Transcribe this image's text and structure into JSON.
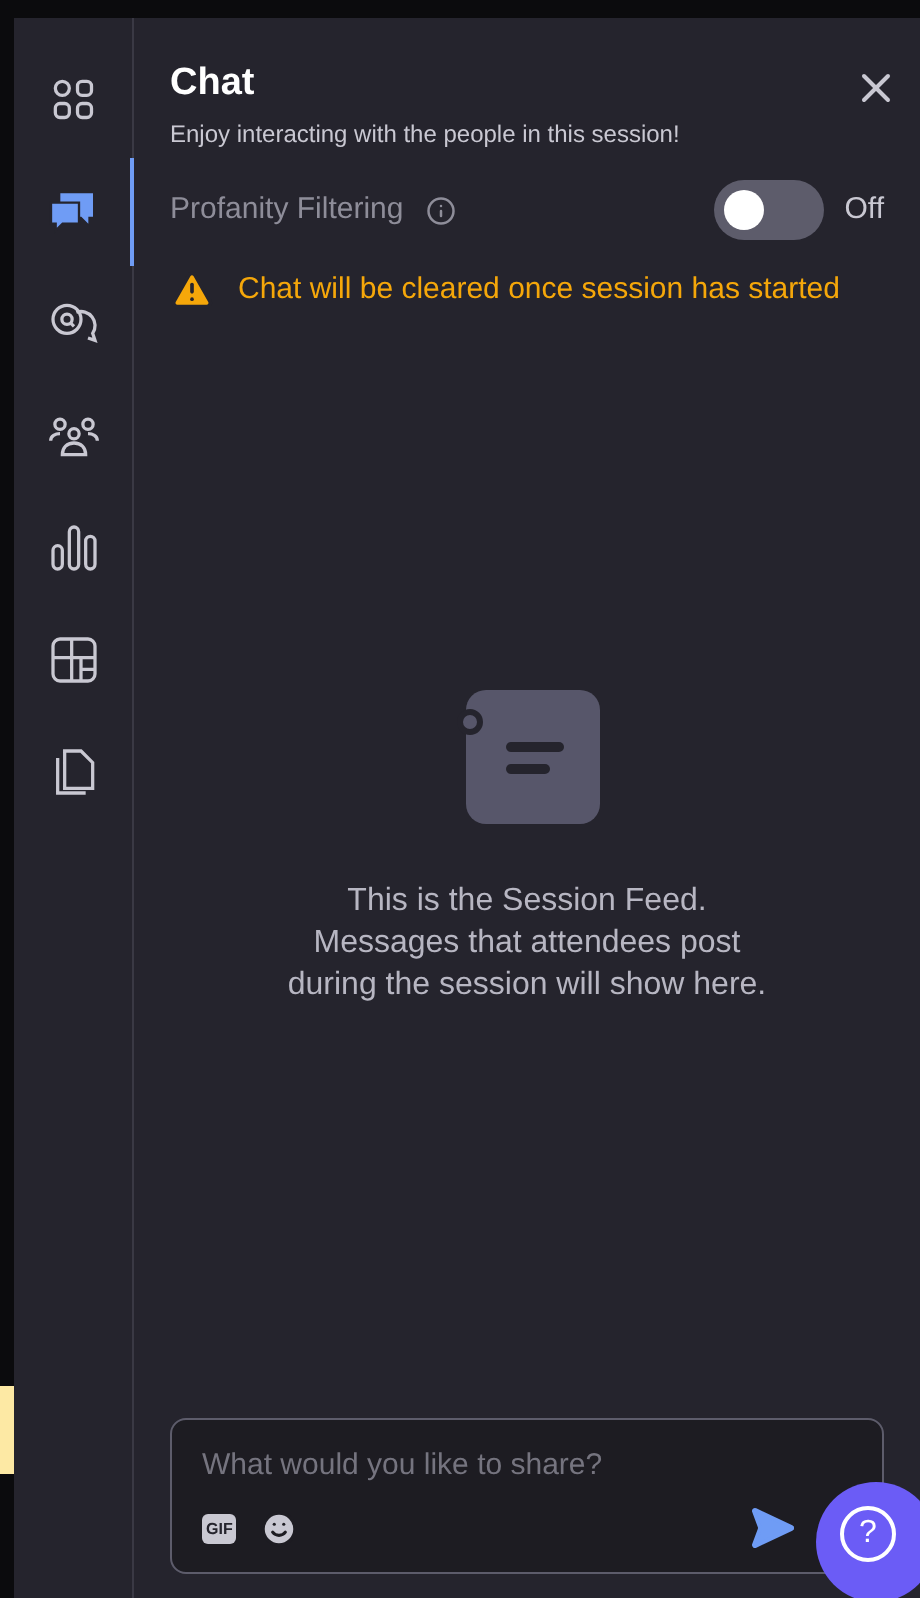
{
  "sidebar": {
    "items": [
      {
        "kind": "settings",
        "selected": false
      },
      {
        "kind": "chat",
        "selected": true
      },
      {
        "kind": "qa",
        "selected": false
      },
      {
        "kind": "people",
        "selected": false
      },
      {
        "kind": "polls",
        "selected": false
      },
      {
        "kind": "layout",
        "selected": false
      },
      {
        "kind": "files",
        "selected": false
      }
    ]
  },
  "header": {
    "title": "Chat",
    "subtitle": "Enjoy interacting with the people in this session!"
  },
  "profanity_filter": {
    "label": "Profanity Filtering",
    "on": false,
    "state_text": "Off"
  },
  "warning": "Chat will be cleared once session has started",
  "empty_state": {
    "lines": [
      "This is the Session Feed.",
      "Messages that attendees post",
      "during the session will show here."
    ]
  },
  "composer": {
    "placeholder": "What would you like to share?",
    "gif_label": "GIF"
  },
  "help_button": "?"
}
